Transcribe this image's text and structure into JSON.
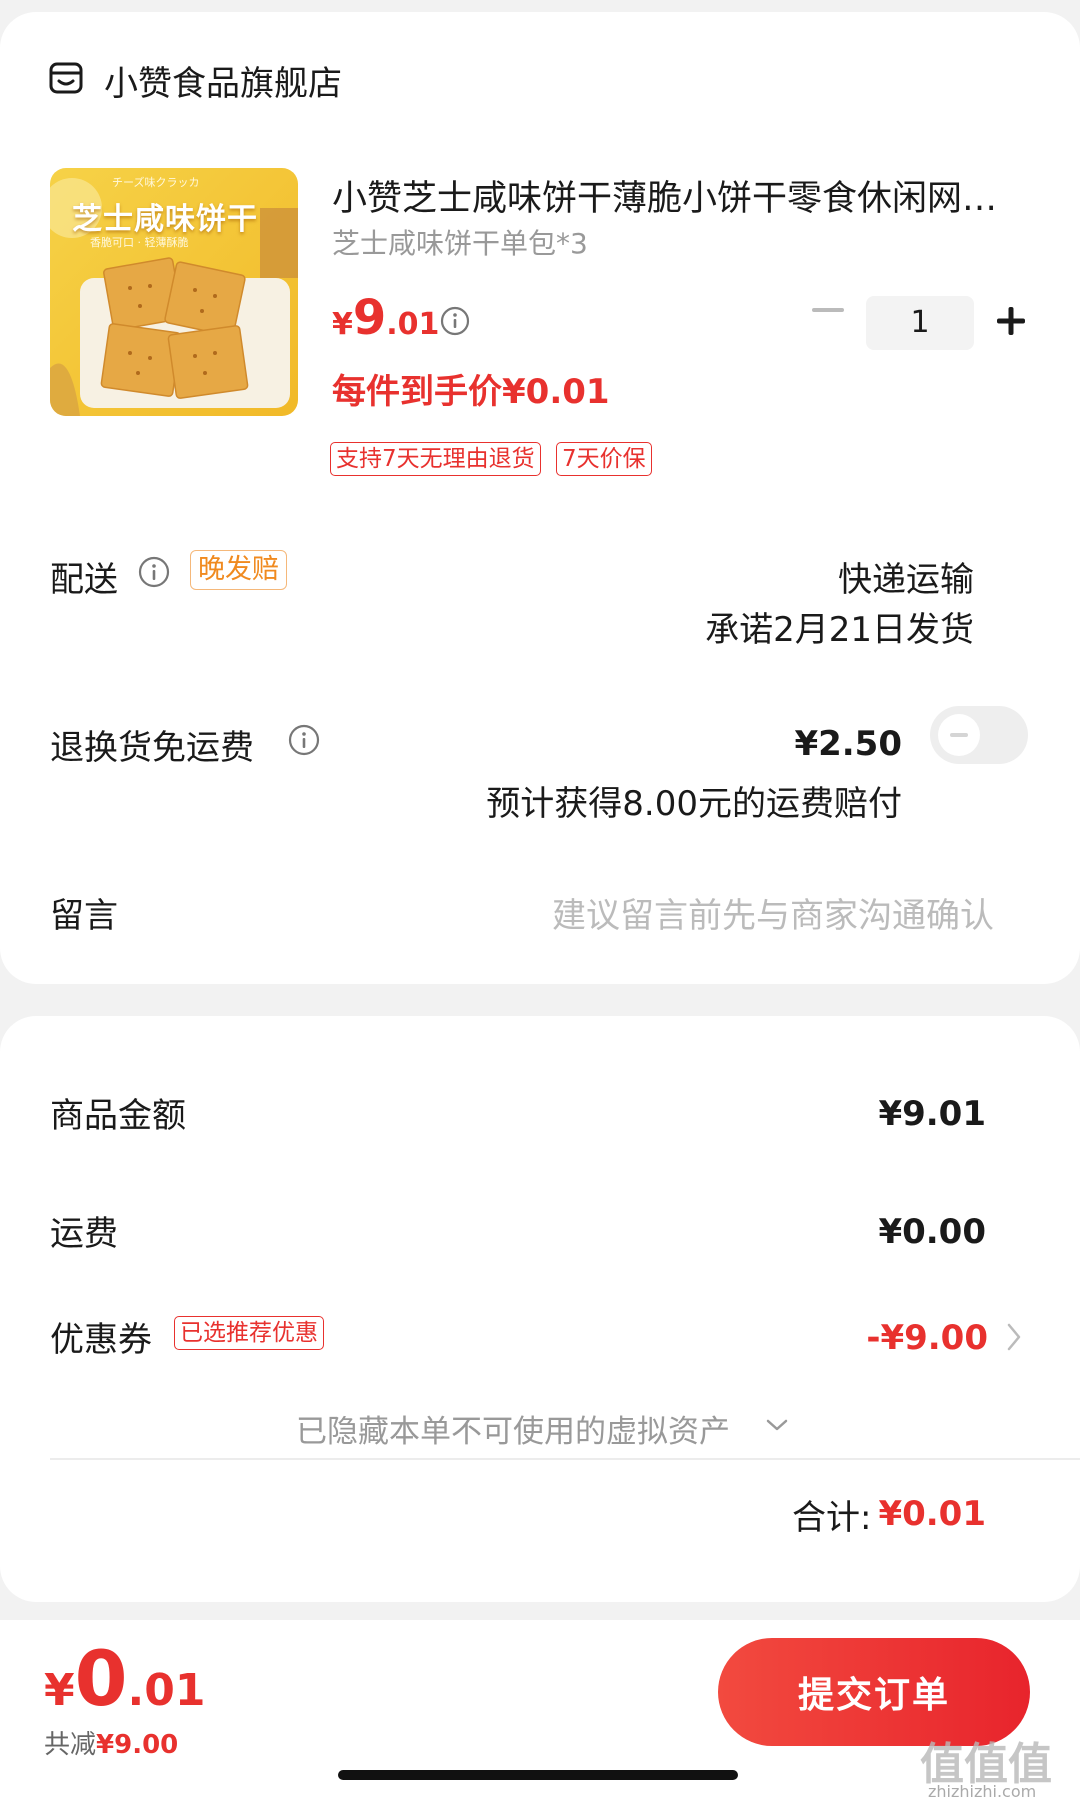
{
  "shop": {
    "name": "小赞食品旗舰店",
    "icon": "store-icon"
  },
  "product": {
    "image_caption_1": "芝士咸味饼干",
    "image_caption_2": "チーズ味クラッカ",
    "image_caption_3": "香脆可口 · 轻薄酥脆",
    "title": "小赞芝士咸味饼干薄脆小饼干零食休闲网…",
    "spec": "芝士咸味饼干单包*3",
    "price_symbol": "¥",
    "price_int": "9",
    "price_dec": ".01",
    "per_item_price": "每件到手价¥0.01",
    "tags": [
      "支持7天无理由退货",
      "7天价保"
    ],
    "quantity": "1"
  },
  "delivery": {
    "label": "配送",
    "tag": "晚发赔",
    "method": "快递运输",
    "promise": "承诺2月21日发货"
  },
  "return_shipping": {
    "label": "退换货免运费",
    "price": "¥2.50",
    "note": "预计获得8.00元的运费赔付",
    "enabled": false
  },
  "message": {
    "label": "留言",
    "placeholder": "建议留言前先与商家沟通确认"
  },
  "summary": {
    "goods_label": "商品金额",
    "goods_value": "¥9.01",
    "shipping_label": "运费",
    "shipping_value": "¥0.00",
    "coupon_label": "优惠券",
    "coupon_tag": "已选推荐优惠",
    "coupon_value": "-¥9.00",
    "hidden_note": "已隐藏本单不可使用的虚拟资产",
    "total_label": "合计:",
    "total_value": "¥0.01"
  },
  "bottom": {
    "total_symbol": "¥",
    "total_int": "0",
    "total_dec": ".01",
    "saved_label": "共减",
    "saved_value": "¥9.00",
    "submit_label": "提交订单",
    "watermark": "值值值",
    "watermark_url": "zhizhizhi.com"
  },
  "colors": {
    "accent": "#e8312e",
    "tag_orange": "#f08a1f"
  }
}
